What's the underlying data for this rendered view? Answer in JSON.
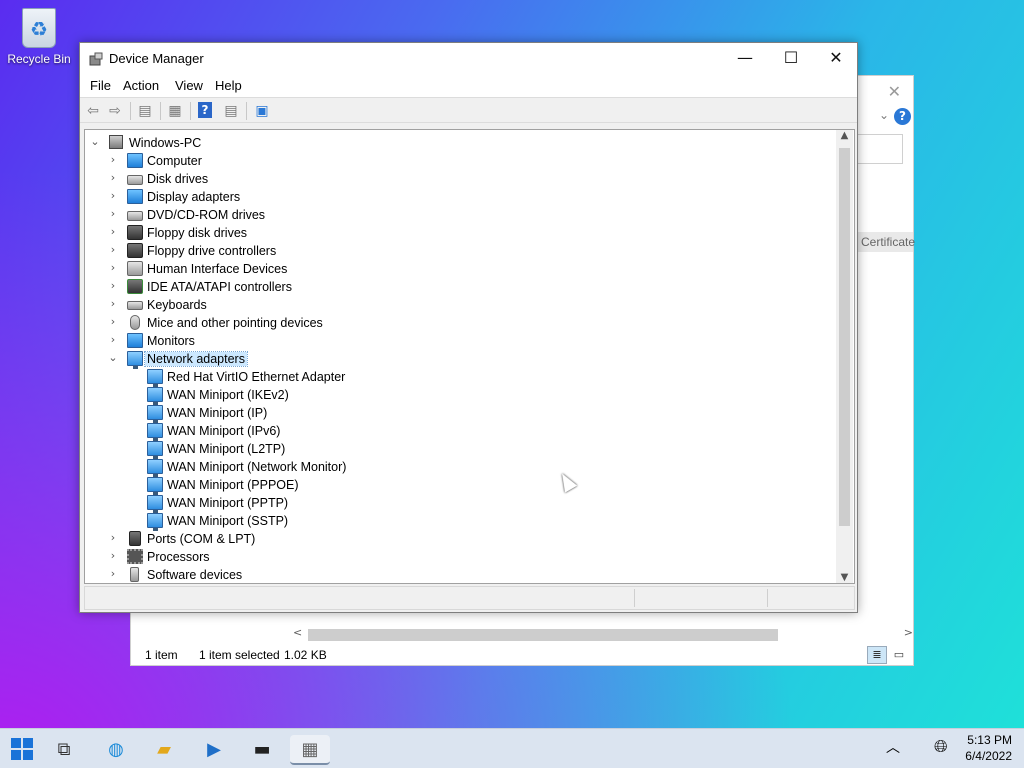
{
  "desktop": {
    "icons": [
      {
        "label": "Recycle Bin",
        "icon": "recycle-bin-icon"
      }
    ]
  },
  "background_window": {
    "column_header": "Certificate",
    "status": {
      "items": "1 item",
      "selected": "1 item selected",
      "size": "1.02 KB"
    }
  },
  "device_manager": {
    "title": "Device Manager",
    "controls": {
      "minimize": "—",
      "maximize": "☐",
      "close": "✕"
    },
    "menu": [
      "File",
      "Action",
      "View",
      "Help"
    ],
    "toolbar": [
      "back-icon",
      "forward-icon",
      "properties-icon",
      "scan-icon",
      "help-icon",
      "view-icon",
      "monitor-icon"
    ],
    "tree": {
      "root": "Windows-PC",
      "categories": [
        {
          "label": "Computer",
          "icon": "computer-icon",
          "expanded": false
        },
        {
          "label": "Disk drives",
          "icon": "disk-drive-icon",
          "expanded": false
        },
        {
          "label": "Display adapters",
          "icon": "display-adapter-icon",
          "expanded": false
        },
        {
          "label": "DVD/CD-ROM drives",
          "icon": "dvd-icon",
          "expanded": false
        },
        {
          "label": "Floppy disk drives",
          "icon": "floppy-icon",
          "expanded": false
        },
        {
          "label": "Floppy drive controllers",
          "icon": "floppy-controller-icon",
          "expanded": false
        },
        {
          "label": "Human Interface Devices",
          "icon": "hid-icon",
          "expanded": false
        },
        {
          "label": "IDE ATA/ATAPI controllers",
          "icon": "ide-icon",
          "expanded": false
        },
        {
          "label": "Keyboards",
          "icon": "keyboard-icon",
          "expanded": false
        },
        {
          "label": "Mice and other pointing devices",
          "icon": "mouse-icon",
          "expanded": false
        },
        {
          "label": "Monitors",
          "icon": "monitor-icon",
          "expanded": false
        },
        {
          "label": "Network adapters",
          "icon": "network-adapter-icon",
          "expanded": true,
          "selected": true
        },
        {
          "label": "Ports (COM & LPT)",
          "icon": "port-icon",
          "expanded": false
        },
        {
          "label": "Processors",
          "icon": "processor-icon",
          "expanded": false
        },
        {
          "label": "Software devices",
          "icon": "software-device-icon",
          "expanded": false
        }
      ],
      "network_children": [
        "Red Hat VirtIO Ethernet Adapter",
        "WAN Miniport (IKEv2)",
        "WAN Miniport (IP)",
        "WAN Miniport (IPv6)",
        "WAN Miniport (L2TP)",
        "WAN Miniport (Network Monitor)",
        "WAN Miniport (PPPOE)",
        "WAN Miniport (PPTP)",
        "WAN Miniport (SSTP)"
      ]
    }
  },
  "taskbar": {
    "apps": [
      "start-icon",
      "task-view-icon",
      "edge-icon",
      "file-explorer-icon",
      "media-icon",
      "terminal-icon",
      "device-manager-icon"
    ],
    "clock": {
      "time": "5:13 PM",
      "date": "6/4/2022"
    }
  }
}
